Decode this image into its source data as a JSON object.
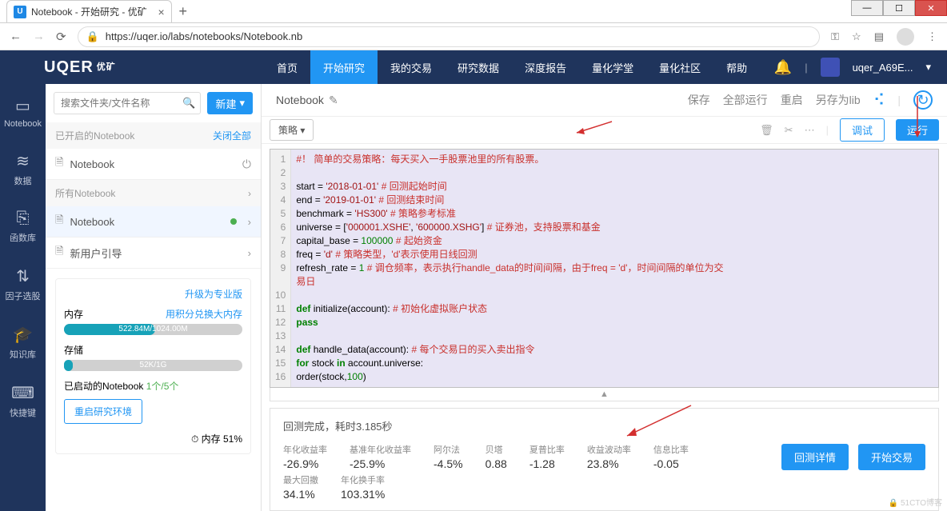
{
  "browser": {
    "tab_title": "Notebook - 开始研究 - 优矿",
    "url": "https://uqer.io/labs/notebooks/Notebook.nb"
  },
  "nav": {
    "logo": "UQER",
    "logo_sub": "优矿",
    "items": [
      "首页",
      "开始研究",
      "我的交易",
      "研究数据",
      "深度报告",
      "量化学堂",
      "量化社区",
      "帮助"
    ],
    "active": 1,
    "user": "uqer_A69E...",
    "user_chev": "▾"
  },
  "rail": [
    {
      "icon": "▭",
      "label": "Notebook"
    },
    {
      "icon": "≋",
      "label": "数据"
    },
    {
      "icon": "⎘",
      "label": "函数库"
    },
    {
      "icon": "⇅",
      "label": "因子选股"
    },
    {
      "icon": "🎓",
      "label": "知识库"
    },
    {
      "icon": "⌨",
      "label": "快捷键"
    }
  ],
  "sidebar": {
    "search_placeholder": "搜索文件夹/文件名称",
    "new_btn": "新建",
    "opened_head": "已开启的Notebook",
    "close_all": "关闭全部",
    "opened_item": "Notebook",
    "all_head": "所有Notebook",
    "all_items": [
      "Notebook",
      "新用户引导"
    ],
    "upgrade": "升级为专业版",
    "mem_label": "内存",
    "mem_link": "用积分兑换大内存",
    "mem_text": "522.84M/1024.00M",
    "mem_pct": 51,
    "store_label": "存储",
    "store_text": "52K/1G",
    "store_pct": 5,
    "started_label": "已启动的Notebook",
    "started_count": "1个/5个",
    "restart": "重启研究环境",
    "mem_status": "⏱ 内存 51%"
  },
  "crumb": {
    "name": "Notebook",
    "actions": [
      "保存",
      "全部运行",
      "重启",
      "另存为lib"
    ]
  },
  "toolbar": {
    "strategy": "策略 ▾",
    "debug": "调试",
    "run": "运行"
  },
  "code": {
    "lines": [
      {
        "n": 1,
        "html": "<span class='com'>#！ 简单的交易策略：每天买入一手股票池里的所有股票。</span>"
      },
      {
        "n": 2,
        "html": ""
      },
      {
        "n": 3,
        "html": "start = <span class='str'>'2018-01-01'</span>                       <span class='com'># 回测起始时间</span>"
      },
      {
        "n": 4,
        "html": "end = <span class='str'>'2019-01-01'</span>                         <span class='com'># 回测结束时间</span>"
      },
      {
        "n": 5,
        "html": "benchmark = <span class='str'>'HS300'</span>                        <span class='com'># 策略参考标准</span>"
      },
      {
        "n": 6,
        "html": "universe = [<span class='str'>'000001.XSHE'</span>, <span class='str'>'600000.XSHG'</span>]  <span class='com'># 证券池，支持股票和基金</span>"
      },
      {
        "n": 7,
        "html": "capital_base = <span class='num'>100000</span>                      <span class='com'># 起始资金</span>"
      },
      {
        "n": 8,
        "html": "freq = <span class='str'>'d'</span>                                 <span class='com'># 策略类型，'d'表示使用日线回测</span>"
      },
      {
        "n": 9,
        "html": "refresh_rate = <span class='num'>1</span>                           <span class='com'># 调仓频率，表示执行handle_data的时间间隔，由于freq = 'd'，时间间隔的单位为交</span>"
      },
      {
        "n": "",
        "html": "<span class='com'>易日</span>"
      },
      {
        "n": 10,
        "html": ""
      },
      {
        "n": 11,
        "html": "<span class='kw'>def</span> initialize(account):                    <span class='com'># 初始化虚拟账户状态</span>"
      },
      {
        "n": 12,
        "html": "    <span class='kw'>pass</span>"
      },
      {
        "n": 13,
        "html": ""
      },
      {
        "n": 14,
        "html": "<span class='kw'>def</span> handle_data(account):                   <span class='com'># 每个交易日的买入卖出指令</span>"
      },
      {
        "n": 15,
        "html": "    <span class='kw'>for</span> stock <span class='kw'>in</span> account.universe:"
      },
      {
        "n": 16,
        "html": "        order(stock,<span class='num'>100</span>)"
      }
    ]
  },
  "result": {
    "title": "回测完成，耗时3.185秒",
    "row1": [
      {
        "label": "年化收益率",
        "val": "-26.9%"
      },
      {
        "label": "基准年化收益率",
        "val": "-25.9%"
      },
      {
        "label": "阿尔法",
        "val": "-4.5%"
      },
      {
        "label": "贝塔",
        "val": "0.88"
      },
      {
        "label": "夏普比率",
        "val": "-1.28"
      },
      {
        "label": "收益波动率",
        "val": "23.8%"
      },
      {
        "label": "信息比率",
        "val": "-0.05"
      }
    ],
    "row2": [
      {
        "label": "最大回撤",
        "val": "34.1%"
      },
      {
        "label": "年化换手率",
        "val": "103.31%"
      }
    ],
    "detail_btn": "回测详情",
    "trade_btn": "开始交易"
  },
  "watermark": "🔒 51CTO博客"
}
